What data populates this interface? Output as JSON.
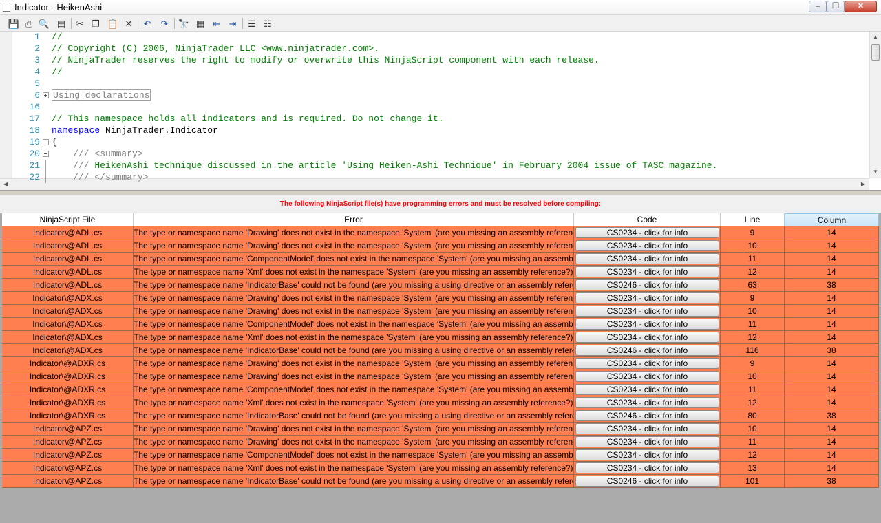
{
  "window": {
    "title": "Indicator - HeikenAshi",
    "minimize": "–",
    "maximize": "❐",
    "close": "✕"
  },
  "toolbar": {
    "buttons": [
      {
        "name": "save-icon",
        "glyph": "💾"
      },
      {
        "name": "print-icon",
        "glyph": "⎙"
      },
      {
        "name": "print-preview-icon",
        "glyph": "🔍"
      },
      {
        "name": "page-setup-icon",
        "glyph": "▤"
      },
      {
        "name": "cut-icon",
        "glyph": "✂"
      },
      {
        "name": "copy-icon",
        "glyph": "❐"
      },
      {
        "name": "paste-icon",
        "glyph": "📋"
      },
      {
        "name": "delete-icon",
        "glyph": "✕"
      },
      {
        "name": "undo-icon",
        "glyph": "↶"
      },
      {
        "name": "redo-icon",
        "glyph": "↷"
      },
      {
        "name": "find-icon",
        "glyph": "🔭"
      },
      {
        "name": "insert-code-icon",
        "glyph": "▦"
      },
      {
        "name": "decrease-indent-icon",
        "glyph": "⇤"
      },
      {
        "name": "increase-indent-icon",
        "glyph": "⇥"
      },
      {
        "name": "comment-icon",
        "glyph": "☰"
      },
      {
        "name": "uncomment-icon",
        "glyph": "☷"
      }
    ]
  },
  "editor": {
    "lines": [
      {
        "n": "1",
        "parts": [
          {
            "t": "//",
            "c": "comment"
          }
        ]
      },
      {
        "n": "2",
        "parts": [
          {
            "t": "// Copyright (C) 2006, NinjaTrader LLC <www.ninjatrader.com>.",
            "c": "comment"
          }
        ]
      },
      {
        "n": "3",
        "parts": [
          {
            "t": "// NinjaTrader reserves the right to modify or overwrite this NinjaScript component with each release.",
            "c": "comment"
          }
        ]
      },
      {
        "n": "4",
        "parts": [
          {
            "t": "//",
            "c": "comment"
          }
        ]
      },
      {
        "n": "5",
        "parts": []
      },
      {
        "n": "6",
        "fold": "plus",
        "parts": [
          {
            "t": "Using declarations",
            "c": "collapsed"
          }
        ]
      },
      {
        "n": "16",
        "parts": []
      },
      {
        "n": "17",
        "parts": [
          {
            "t": "// This namespace holds all indicators and is required. Do not change it.",
            "c": "comment"
          }
        ]
      },
      {
        "n": "18",
        "parts": [
          {
            "t": "namespace",
            "c": "kw"
          },
          {
            "t": " NinjaTrader.Indicator",
            "c": "plain"
          }
        ]
      },
      {
        "n": "19",
        "fold": "minus",
        "parts": [
          {
            "t": "{",
            "c": "plain"
          }
        ]
      },
      {
        "n": "20",
        "fold": "minus",
        "parts": [
          {
            "t": "    /// <summary>",
            "c": "gray"
          }
        ]
      },
      {
        "n": "21",
        "fold": "line",
        "parts": [
          {
            "t": "    /// ",
            "c": "gray"
          },
          {
            "t": "HeikenAshi technique discussed in the article 'Using Heiken-Ashi Technique' in February 2004 issue of TASC magazine.",
            "c": "comment"
          }
        ]
      },
      {
        "n": "22",
        "fold": "line",
        "parts": [
          {
            "t": "    /// </summary>",
            "c": "gray"
          }
        ]
      }
    ]
  },
  "errors": {
    "message": "The following NinjaScript file(s) have programming errors and must be resolved before compiling:",
    "columns": [
      {
        "key": "file",
        "label": "NinjaScript File"
      },
      {
        "key": "error",
        "label": "Error"
      },
      {
        "key": "code",
        "label": "Code"
      },
      {
        "key": "line",
        "label": "Line"
      },
      {
        "key": "column",
        "label": "Column"
      }
    ],
    "rows": [
      {
        "file": "Indicator\\@ADL.cs",
        "error": "The type or namespace name 'Drawing' does not exist in the namespace 'System' (are you missing an assembly reference?)",
        "code": "CS0234 - click for info",
        "line": "9",
        "column": "14"
      },
      {
        "file": "Indicator\\@ADL.cs",
        "error": "The type or namespace name 'Drawing' does not exist in the namespace 'System' (are you missing an assembly reference?)",
        "code": "CS0234 - click for info",
        "line": "10",
        "column": "14"
      },
      {
        "file": "Indicator\\@ADL.cs",
        "error": "The type or namespace name 'ComponentModel' does not exist in the namespace 'System' (are you missing an assembly ref",
        "code": "CS0234 - click for info",
        "line": "11",
        "column": "14"
      },
      {
        "file": "Indicator\\@ADL.cs",
        "error": "The type or namespace name 'Xml' does not exist in the namespace 'System' (are you missing an assembly reference?)",
        "code": "CS0234 - click for info",
        "line": "12",
        "column": "14"
      },
      {
        "file": "Indicator\\@ADL.cs",
        "error": "The type or namespace name 'IndicatorBase' could not be found (are you missing a using directive or an assembly reference?",
        "code": "CS0246 - click for info",
        "line": "63",
        "column": "38"
      },
      {
        "file": "Indicator\\@ADX.cs",
        "error": "The type or namespace name 'Drawing' does not exist in the namespace 'System' (are you missing an assembly reference?)",
        "code": "CS0234 - click for info",
        "line": "9",
        "column": "14"
      },
      {
        "file": "Indicator\\@ADX.cs",
        "error": "The type or namespace name 'Drawing' does not exist in the namespace 'System' (are you missing an assembly reference?)",
        "code": "CS0234 - click for info",
        "line": "10",
        "column": "14"
      },
      {
        "file": "Indicator\\@ADX.cs",
        "error": "The type or namespace name 'ComponentModel' does not exist in the namespace 'System' (are you missing an assembly ref",
        "code": "CS0234 - click for info",
        "line": "11",
        "column": "14"
      },
      {
        "file": "Indicator\\@ADX.cs",
        "error": "The type or namespace name 'Xml' does not exist in the namespace 'System' (are you missing an assembly reference?)",
        "code": "CS0234 - click for info",
        "line": "12",
        "column": "14"
      },
      {
        "file": "Indicator\\@ADX.cs",
        "error": "The type or namespace name 'IndicatorBase' could not be found (are you missing a using directive or an assembly reference?",
        "code": "CS0246 - click for info",
        "line": "116",
        "column": "38"
      },
      {
        "file": "Indicator\\@ADXR.cs",
        "error": "The type or namespace name 'Drawing' does not exist in the namespace 'System' (are you missing an assembly reference?)",
        "code": "CS0234 - click for info",
        "line": "9",
        "column": "14"
      },
      {
        "file": "Indicator\\@ADXR.cs",
        "error": "The type or namespace name 'Drawing' does not exist in the namespace 'System' (are you missing an assembly reference?)",
        "code": "CS0234 - click for info",
        "line": "10",
        "column": "14"
      },
      {
        "file": "Indicator\\@ADXR.cs",
        "error": "The type or namespace name 'ComponentModel' does not exist in the namespace 'System' (are you missing an assembly ref",
        "code": "CS0234 - click for info",
        "line": "11",
        "column": "14"
      },
      {
        "file": "Indicator\\@ADXR.cs",
        "error": "The type or namespace name 'Xml' does not exist in the namespace 'System' (are you missing an assembly reference?)",
        "code": "CS0234 - click for info",
        "line": "12",
        "column": "14"
      },
      {
        "file": "Indicator\\@ADXR.cs",
        "error": "The type or namespace name 'IndicatorBase' could not be found (are you missing a using directive or an assembly reference?",
        "code": "CS0246 - click for info",
        "line": "80",
        "column": "38"
      },
      {
        "file": "Indicator\\@APZ.cs",
        "error": "The type or namespace name 'Drawing' does not exist in the namespace 'System' (are you missing an assembly reference?)",
        "code": "CS0234 - click for info",
        "line": "10",
        "column": "14"
      },
      {
        "file": "Indicator\\@APZ.cs",
        "error": "The type or namespace name 'Drawing' does not exist in the namespace 'System' (are you missing an assembly reference?)",
        "code": "CS0234 - click for info",
        "line": "11",
        "column": "14"
      },
      {
        "file": "Indicator\\@APZ.cs",
        "error": "The type or namespace name 'ComponentModel' does not exist in the namespace 'System' (are you missing an assembly ref",
        "code": "CS0234 - click for info",
        "line": "12",
        "column": "14"
      },
      {
        "file": "Indicator\\@APZ.cs",
        "error": "The type or namespace name 'Xml' does not exist in the namespace 'System' (are you missing an assembly reference?)",
        "code": "CS0234 - click for info",
        "line": "13",
        "column": "14"
      },
      {
        "file": "Indicator\\@APZ.cs",
        "error": "The type or namespace name 'IndicatorBase' could not be found (are you missing a using directive or an assembly reference?",
        "code": "CS0246 - click for info",
        "line": "101",
        "column": "38"
      }
    ]
  },
  "colors": {
    "error_row": "#ff7f50",
    "error_message": "#ff0000",
    "comment": "#008000",
    "keyword": "#0000ff",
    "line_number": "#2b91af"
  }
}
